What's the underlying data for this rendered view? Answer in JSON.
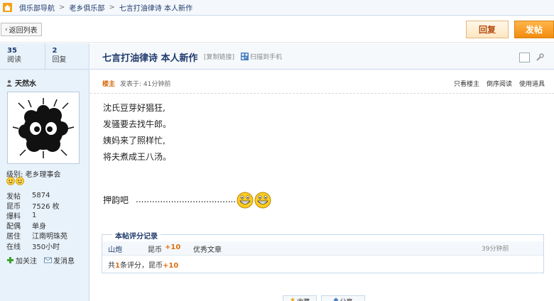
{
  "nav": {
    "icon": "home-icon",
    "crumbs": [
      "俱乐部导航",
      "老乡俱乐部",
      "七言打油律诗 本人新作"
    ],
    "separator": ">"
  },
  "toolbar": {
    "back_label": "返回列表",
    "reply_label": "回复",
    "post_label": "发帖"
  },
  "stats": {
    "views": "35",
    "views_label": "阅读",
    "replies": "2",
    "replies_label": "回复"
  },
  "author": {
    "name": "天然水",
    "level_label": "级别: 老乡理事会",
    "info": [
      {
        "k": "发帖",
        "v": "5874"
      },
      {
        "k": "昆币",
        "v": "7526 枚"
      },
      {
        "k": "爆料",
        "v": "1"
      },
      {
        "k": "配偶",
        "v": "单身"
      },
      {
        "k": "居住",
        "v": "江南明珠苑"
      },
      {
        "k": "在线",
        "v": "350小时"
      }
    ],
    "follow_label": "加关注",
    "message_label": "发消息"
  },
  "post": {
    "title": "七言打油律诗 本人新作",
    "copy_link": "[复制链接]",
    "qr_label": "扫描到手机",
    "owner_badge": "楼主",
    "posted_time": "发表于: 41分钟前",
    "ops": [
      "只看楼主",
      "倒序阅读",
      "使用道具"
    ],
    "poem": [
      "沈氏豆芽好猖狂,",
      "发骚要去找牛郎。",
      "姨妈来了照样忙,",
      "将夫煮成王八汤。"
    ],
    "rhyme_text": "押韵吧",
    "dots": ".....................................",
    "emoticon": "grinning-face-icon"
  },
  "rating": {
    "title": "本帖评分记录",
    "user": "山炮",
    "field": "昆币",
    "value": "+10",
    "reason": "优秀文章",
    "time": "39分钟前",
    "summary_prefix": "共",
    "summary_count": "1",
    "summary_mid": "条评分，昆币",
    "summary_total": "+10"
  },
  "bottom": {
    "btn1": "收藏",
    "btn2": "分享"
  },
  "colors": {
    "link_blue": "#1f3a6b",
    "accent_orange": "#f28b0e",
    "sidebar_bg": "#e8f2fb"
  }
}
